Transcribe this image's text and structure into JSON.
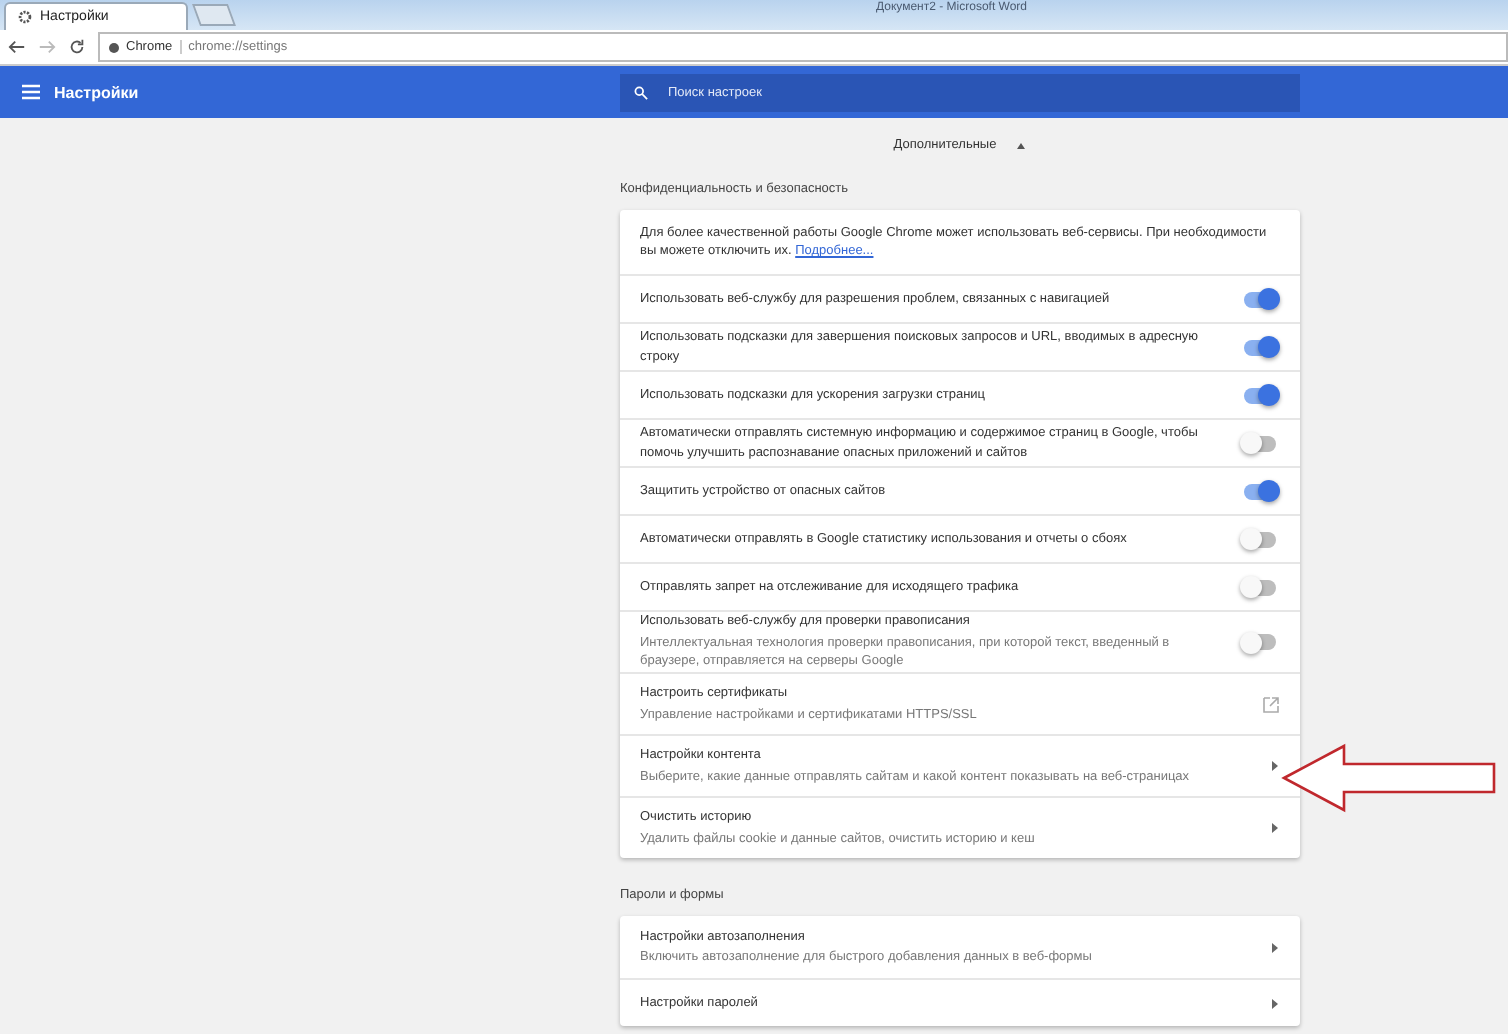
{
  "browser": {
    "tab_title": "Настройки",
    "background_window_title": "Документ2 - Microsoft Word",
    "site_label": "Chrome",
    "url": "chrome://settings"
  },
  "header": {
    "title": "Настройки",
    "search": {
      "placeholder": "Поиск настроек"
    }
  },
  "advanced": {
    "label": "Дополнительные",
    "expanded": true
  },
  "sections": [
    {
      "title": "Конфиденциальность и безопасность",
      "rows": [
        {
          "kind": "intro",
          "text": "Для более качественной работы Google Chrome может использовать веб-сервисы. При необходимости вы можете отключить их.",
          "link": "Подробнее..."
        },
        {
          "kind": "toggle",
          "label": "Использовать веб-службу для разрешения проблем, связанных с навигацией",
          "on": true
        },
        {
          "kind": "toggle",
          "label": "Использовать подсказки для завершения поисковых запросов и URL, вводимых в адресную строку",
          "on": true
        },
        {
          "kind": "toggle",
          "label": "Использовать подсказки для ускорения загрузки страниц",
          "on": true
        },
        {
          "kind": "toggle",
          "label": "Автоматически отправлять системную информацию и содержимое страниц в Google, чтобы помочь улучшить распознавание опасных приложений и сайтов",
          "on": false
        },
        {
          "kind": "toggle",
          "label": "Защитить устройство от опасных сайтов",
          "on": true
        },
        {
          "kind": "toggle",
          "label": "Автоматически отправлять в Google статистику использования и отчеты о сбоях",
          "on": false
        },
        {
          "kind": "toggle",
          "label": "Отправлять запрет на отслеживание для исходящего трафика",
          "on": false
        },
        {
          "kind": "toggle",
          "label": "Использовать веб-службу для проверки правописания",
          "sub": "Интеллектуальная технология проверки правописания, при которой текст, введенный в браузере, отправляется на серверы Google",
          "on": false
        },
        {
          "kind": "external",
          "label": "Настроить сертификаты",
          "sub": "Управление настройками и сертификатами HTTPS/SSL"
        },
        {
          "kind": "subpage",
          "label": "Настройки контента",
          "sub": "Выберите, какие данные отправлять сайтам и какой контент показывать на веб-страницах"
        },
        {
          "kind": "subpage",
          "label": "Очистить историю",
          "sub": "Удалить файлы cookie и данные сайтов, очистить историю и кеш"
        }
      ]
    },
    {
      "title": "Пароли и формы",
      "rows": [
        {
          "kind": "subpage",
          "label": "Настройки автозаполнения",
          "sub": "Включить автозаполнение для быстрого добавления данных в веб-формы"
        },
        {
          "kind": "subpage",
          "label": "Настройки паролей"
        }
      ]
    }
  ]
}
